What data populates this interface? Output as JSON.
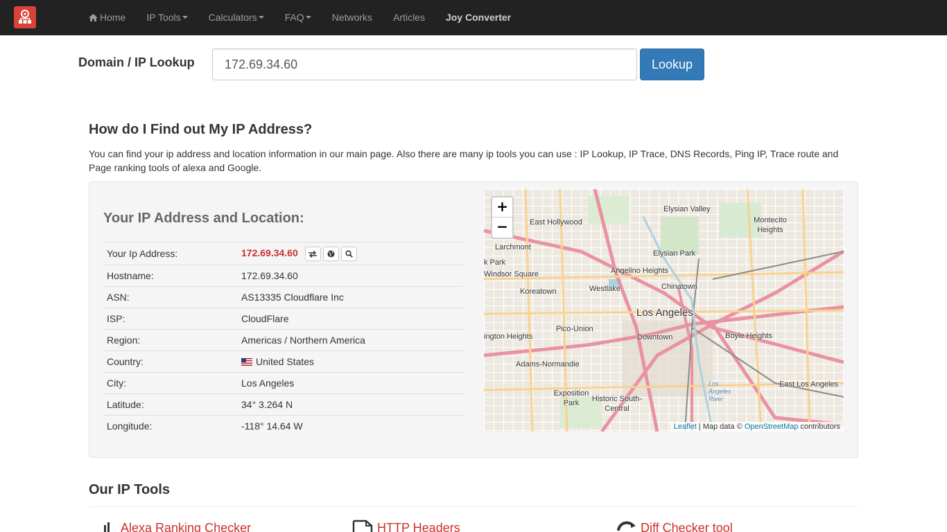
{
  "nav": {
    "items": [
      {
        "label": "Home",
        "icon": "home-icon",
        "dropdown": false
      },
      {
        "label": "IP Tools",
        "dropdown": true
      },
      {
        "label": "Calculators",
        "dropdown": true
      },
      {
        "label": "FAQ",
        "dropdown": true
      },
      {
        "label": "Networks",
        "dropdown": false
      },
      {
        "label": "Articles",
        "dropdown": false
      },
      {
        "label": "Joy Converter",
        "dropdown": false
      }
    ]
  },
  "lookup": {
    "label": "Domain / IP Lookup",
    "value": "172.69.34.60",
    "button": "Lookup"
  },
  "intro": {
    "title": "How do I Find out My IP Address?",
    "text": "You can find your ip address and location information in our main page. Also there are many ip tools you can use : IP Lookup, IP Trace, DNS Records, Ping IP, Trace route and Page ranking tools of alexa and Google."
  },
  "location": {
    "title": "Your IP Address and Location:",
    "rows": [
      {
        "key": "Your Ip Address:",
        "value": "172.69.34.60"
      },
      {
        "key": "Hostname:",
        "value": "172.69.34.60"
      },
      {
        "key": "ASN:",
        "value": "AS13335 Cloudflare Inc"
      },
      {
        "key": "ISP:",
        "value": "CloudFlare"
      },
      {
        "key": "Region:",
        "value": "Americas / Northern America"
      },
      {
        "key": "Country:",
        "value": "United States"
      },
      {
        "key": "City:",
        "value": "Los Angeles"
      },
      {
        "key": "Latitude:",
        "value": "34° 3.264 N"
      },
      {
        "key": "Longitude:",
        "value": "-118° 14.64 W"
      }
    ]
  },
  "map": {
    "zoom_in": "+",
    "zoom_out": "−",
    "attribution": {
      "leaflet": "Leaflet",
      "middle": " | Map data © ",
      "osm": "OpenStreetMap",
      "end": " contributors"
    },
    "labels": [
      "Elysian Valley",
      "Montecito Heights",
      "East Hollywood",
      "Larchmont",
      "Elysian Park",
      "Angelino Heights",
      "Windsor Square",
      "Chinatown",
      "Westlake",
      "Koreatown",
      "Los Angeles",
      "Pico-Union",
      "Downtown",
      "Boyle Heights",
      "Adams-Normandie",
      "East Los Angeles",
      "Exposition Park",
      "Historic South-Central",
      "Los Angeles River",
      "k Park",
      "ington Heights"
    ]
  },
  "tools": {
    "title": "Our IP Tools",
    "items": [
      "Alexa Ranking Checker",
      "HTTP Headers",
      "Diff Checker tool"
    ]
  },
  "colors": {
    "navbar": "#222222",
    "brand": "#d9413b",
    "primary": "#337ab7",
    "ip_red": "#c9302c"
  }
}
